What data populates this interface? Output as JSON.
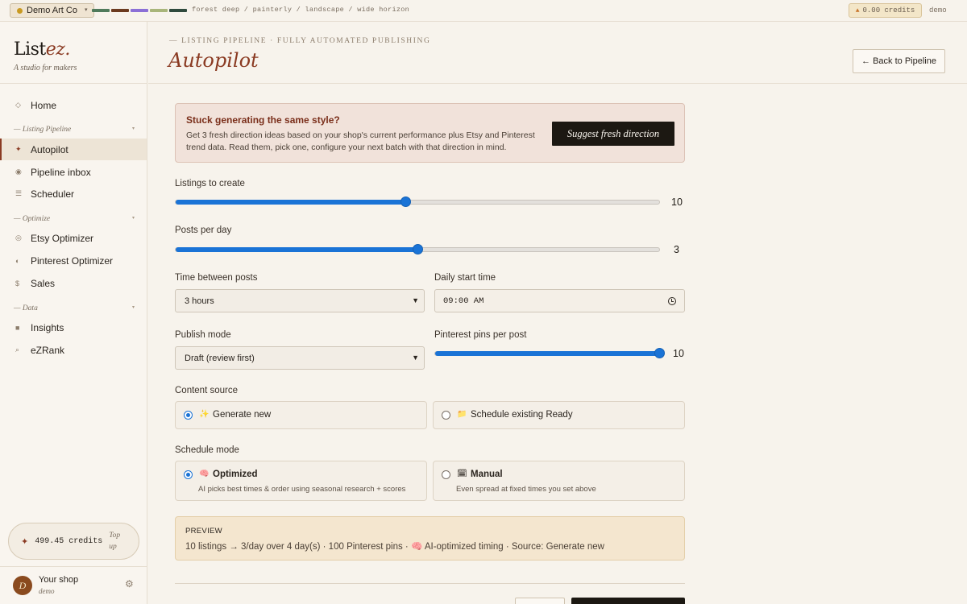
{
  "topbar": {
    "shop_name": "Demo Art Co",
    "palette": [
      "#4f7a5b",
      "#6b3a1f",
      "#8b6fd6",
      "#a8b57a",
      "#2f4a3d"
    ],
    "style_tags": "forest deep / painterly / landscape / wide horizon",
    "credits": "0.00 credits",
    "user": "demo"
  },
  "sidebar": {
    "brand_main": "List",
    "brand_accent": "ez.",
    "brand_tagline": "A studio for makers",
    "home": "Home",
    "groups": {
      "pipeline": "— Listing Pipeline",
      "optimize": "— Optimize",
      "data": "— Data"
    },
    "items": {
      "autopilot": "Autopilot",
      "inbox": "Pipeline inbox",
      "scheduler": "Scheduler",
      "etsy": "Etsy Optimizer",
      "pinterest": "Pinterest Optimizer",
      "sales": "Sales",
      "insights": "Insights",
      "ezrank": "eZRank"
    },
    "credits": "499.45 credits",
    "top_up": "Top up",
    "shop_title": "Your shop",
    "shop_user": "demo",
    "avatar_initial": "D"
  },
  "header": {
    "eyebrow": "— LISTING PIPELINE · FULLY AUTOMATED PUBLISHING",
    "title": "Autopilot",
    "back_button": "← Back to Pipeline"
  },
  "callout": {
    "title": "Stuck generating the same style?",
    "body": "Get 3 fresh direction ideas based on your shop's current performance plus Etsy and Pinterest trend data. Read them, pick one, configure your next batch with that direction in mind.",
    "button": "Suggest fresh direction"
  },
  "form": {
    "listings_label": "Listings to create",
    "listings_value": "10",
    "listings_fraction": 0.475,
    "posts_label": "Posts per day",
    "posts_value": "3",
    "posts_fraction": 0.5,
    "interval_label": "Time between posts",
    "interval_value": "3 hours",
    "start_label": "Daily start time",
    "start_value": "09:00 AM",
    "publish_label": "Publish mode",
    "publish_value": "Draft (review first)",
    "pins_label": "Pinterest pins per post",
    "pins_value": "10",
    "pins_fraction": 1.0,
    "content_label": "Content source",
    "content_options": [
      {
        "emoji": "✨",
        "label": "Generate new",
        "selected": true
      },
      {
        "emoji": "📁",
        "label": "Schedule existing Ready",
        "selected": false
      }
    ],
    "schedule_label": "Schedule mode",
    "schedule_options": [
      {
        "emoji": "🧠",
        "label": "Optimized",
        "sub": "AI picks best times & order using seasonal research + scores",
        "selected": true
      },
      {
        "emoji": "🗓",
        "label": "Manual",
        "sub": "Even spread at fixed times you set above",
        "selected": false
      }
    ]
  },
  "preview": {
    "label": "PREVIEW",
    "text": "10 listings → 3/day over 4 day(s) · 100 Pinterest pins · 🧠 AI-optimized timing · Source: Generate new"
  }
}
